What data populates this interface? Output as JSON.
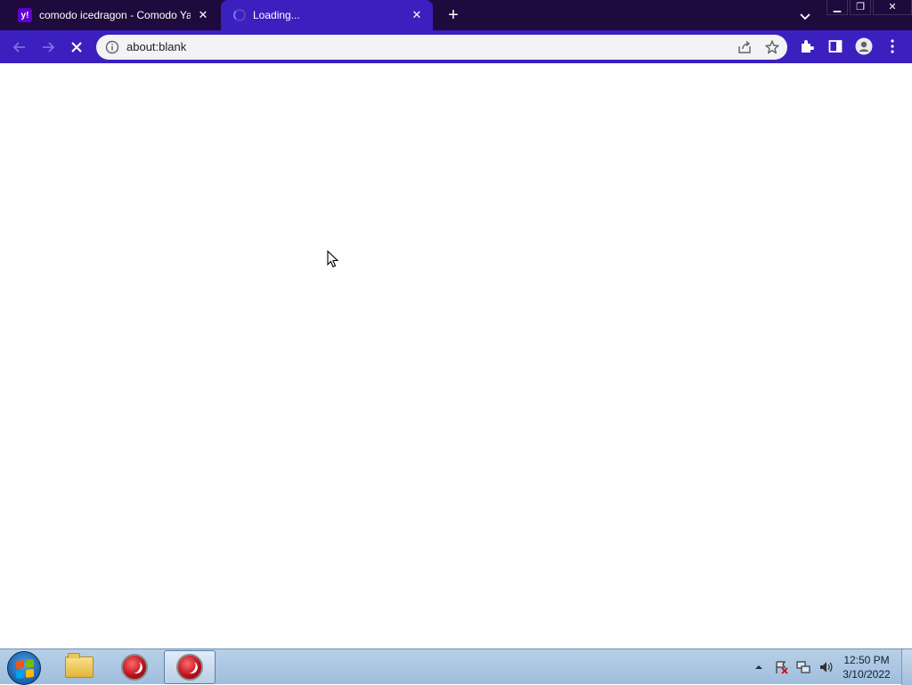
{
  "browser": {
    "tabs": [
      {
        "title": "comodo icedragon - Comodo Ya",
        "favicon": "y!",
        "active": false
      },
      {
        "title": "Loading...",
        "active": true
      }
    ],
    "omnibox": {
      "url": "about:blank"
    }
  },
  "taskbar": {
    "clock": {
      "time": "12:50 PM",
      "date": "3/10/2022"
    }
  },
  "colors": {
    "tabstrip": "#1e0a3c",
    "toolbar": "#3c1fbf",
    "taskbar": "#a9c4e0"
  }
}
